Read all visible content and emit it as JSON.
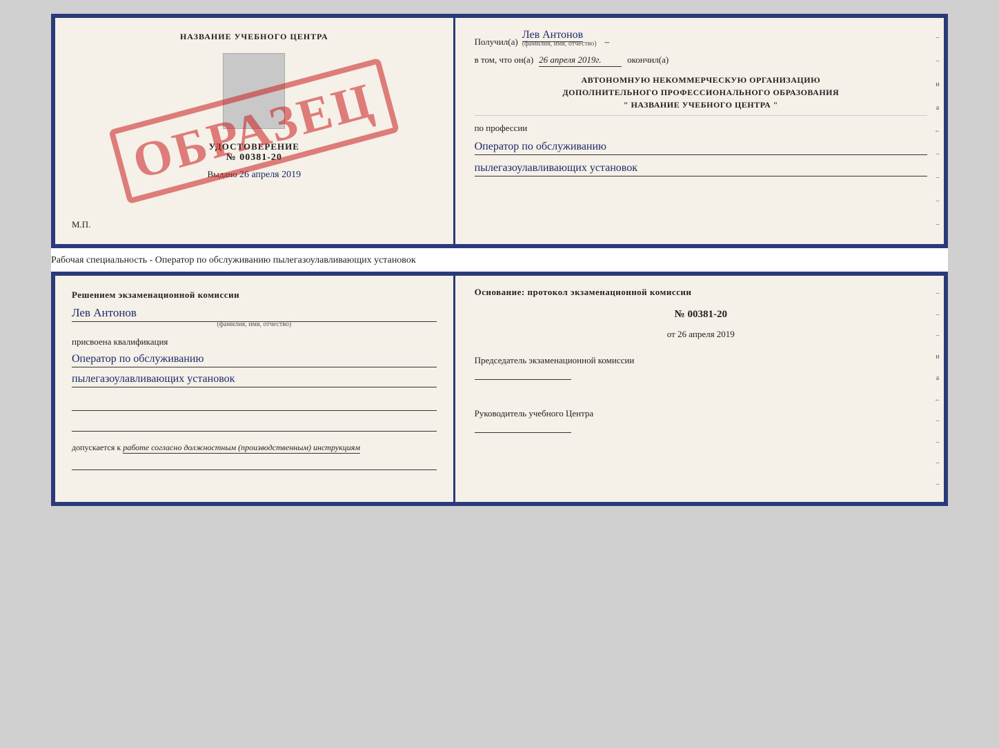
{
  "page": {
    "background": "#d0d0d0"
  },
  "cert_top": {
    "left": {
      "school_name": "НАЗВАНИЕ УЧЕБНОГО ЦЕНТРА",
      "cert_label": "УДОСТОВЕРЕНИЕ",
      "cert_number": "№ 00381-20",
      "issued_label": "Выдано",
      "issued_date": "26 апреля 2019",
      "stamp_text": "ОБРАЗЕЦ",
      "mp_label": "М.П."
    },
    "right": {
      "received_label": "Получил(а)",
      "received_name": "Лев Антонов",
      "fio_hint": "(фамилия, имя, отчество)",
      "date_intro": "в том, что он(а)",
      "date_value": "26 апреля 2019г.",
      "date_end": "окончил(а)",
      "org_line1": "АВТОНОМНУЮ НЕКОММЕРЧЕСКУЮ ОРГАНИЗАЦИЮ",
      "org_line2": "ДОПОЛНИТЕЛЬНОГО ПРОФЕССИОНАЛЬНОГО ОБРАЗОВАНИЯ",
      "org_name": "\"   НАЗВАНИЕ УЧЕБНОГО ЦЕНТРА   \"",
      "profession_label": "по профессии",
      "profession_line1": "Оператор по обслуживанию",
      "profession_line2": "пылегазоулавливающих установок"
    }
  },
  "separator": {
    "text": "Рабочая специальность - Оператор по обслуживанию пылегазоулавливающих установок"
  },
  "cert_bottom": {
    "left": {
      "decision_text": "Решением экзаменационной комиссии",
      "person_name": "Лев Антонов",
      "fio_hint": "(фамилия, имя, отчество)",
      "qualification_label": "присвоена квалификация",
      "qualification_line1": "Оператор по обслуживанию",
      "qualification_line2": "пылегазоулавливающих установок",
      "allowed_label": "допускается к",
      "allowed_text": "работе согласно должностным (производственным) инструкциям"
    },
    "right": {
      "base_label": "Основание: протокол экзаменационной комиссии",
      "protocol_number": "№  00381-20",
      "protocol_date_prefix": "от",
      "protocol_date": "26 апреля 2019",
      "chairman_label": "Председатель экзаменационной комиссии",
      "director_label": "Руководитель учебного Центра"
    }
  },
  "side_chars": [
    "–",
    "–",
    "–",
    "и",
    "а̊",
    "←",
    "–",
    "–",
    "–",
    "–"
  ]
}
